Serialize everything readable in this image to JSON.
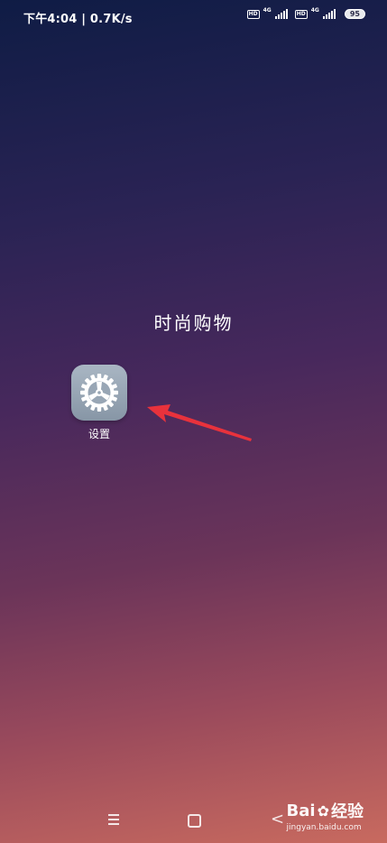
{
  "status_bar": {
    "time_speed": "下午4:04 | 0.7K/s",
    "sim1_hd": "HD",
    "sim1_net": "4G",
    "sim2_hd": "HD",
    "sim2_net": "4G",
    "battery": "95"
  },
  "folder": {
    "title": "时尚购物",
    "apps": [
      {
        "label": "设置",
        "icon": "gear-icon"
      }
    ]
  },
  "annotation": {
    "arrow_color": "#e8323c"
  },
  "nav_bar": {
    "back_glyph": "<"
  },
  "watermark": {
    "brand_left": "Bai",
    "brand_right": "经验",
    "url": "jingyan.baidu.com"
  }
}
